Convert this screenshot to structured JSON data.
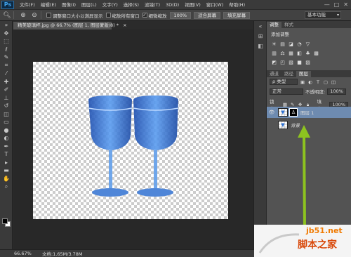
{
  "app": {
    "logo": "Ps"
  },
  "menu": [
    "文件(F)",
    "编辑(E)",
    "图像(I)",
    "图层(L)",
    "文字(Y)",
    "选择(S)",
    "滤镜(T)",
    "3D(D)",
    "视图(V)",
    "窗口(W)",
    "帮助(H)"
  ],
  "window_controls": [
    "—",
    "□",
    "✕"
  ],
  "options": {
    "checkbox_resize": "调整窗口大小以满屏显示",
    "checkbox_zoom_all": "缩放所有窗口",
    "checkbox_scrubby": "细微缩放",
    "btn_100": "100%",
    "btn_fit": "适合屏幕",
    "btn_fill": "填充屏幕",
    "workspace": "基本功能"
  },
  "document": {
    "tab": "精美玻璃杯.jpg @ 66.7% (图层 1, 图层蒙版/8) *",
    "tab_close": "×",
    "zoom": "66.67%",
    "docinfo": "文档:1.65M/3.78M"
  },
  "panels": {
    "adjust_tabs": [
      "调整",
      "样式"
    ],
    "adjust_title": "添加调整",
    "adjust_row1": [
      "☀",
      "▤",
      "◪",
      "◔",
      "▽"
    ],
    "adjust_row2": [
      "▥",
      "⚖",
      "▦",
      "◧",
      "♣",
      "▩"
    ],
    "adjust_row3": [
      "◩",
      "◰",
      "▧",
      "■",
      "▨"
    ],
    "layer_tabs": [
      "通道",
      "路径",
      "图层"
    ],
    "filter_kind": "ρ 类型",
    "blend_mode": "正常",
    "opacity_label": "不透明度:",
    "opacity_value": "100%",
    "lock_label": "锁定:",
    "fill_label": "填充:",
    "fill_value": "100%",
    "layers": [
      {
        "name": "图层 1",
        "selected": true,
        "visible": true
      },
      {
        "name": "背景",
        "selected": false,
        "visible": false
      }
    ]
  },
  "watermark": {
    "line1": "jb51.net",
    "line2": "脚本之家"
  },
  "colors": {
    "selected_layer": "#6e8bb0",
    "arrow": "#8dc31f",
    "glass": "#2f6fd3"
  }
}
